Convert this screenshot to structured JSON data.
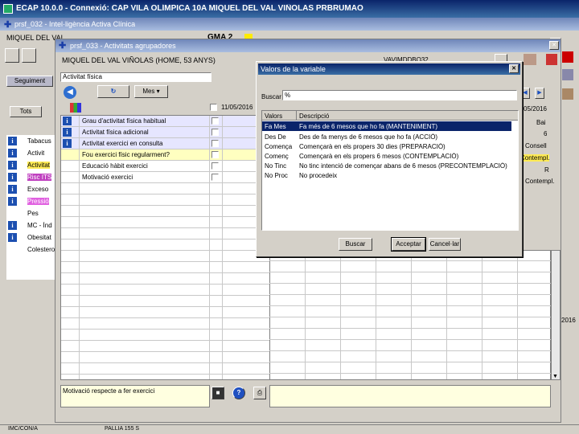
{
  "main_window": {
    "title": "ECAP 10.0.0 - Connexió: CAP VILA OLÍMPICA 10A MIQUEL DEL VAL VIÑOLAS PRBRUMAO"
  },
  "clinical_window": {
    "title": "prsf_032 - Intel·ligència Activa Clínica",
    "patient_bar": "MIQUEL DEL VAL",
    "gma_label": "GMA 2",
    "segment_btn": "Seguiment",
    "tots_label": "Tots",
    "items": [
      "Tabacus",
      "Activit",
      "Activitat",
      "Risc ITS",
      "Exceso",
      "Pressió",
      "Pes",
      "MC - Índ",
      "Obesitat",
      "Colesterol"
    ]
  },
  "status_bar": {
    "item1": "IMC/CON/A",
    "item2": "PALLIA 155 S"
  },
  "grouper_window": {
    "title": "prsf_033 - Activitats agrupadores",
    "patient": "MIQUEL DEL VAL VIÑOLAS (HOME, 53 ANYS)",
    "id": "VAVIMDDBO32",
    "category": "Activitat física",
    "period": "Mes",
    "date_col": "11/05/2016",
    "date_right": "05/2016",
    "activities": [
      "Grau d'activitat física habitual",
      "Activitat física adicional",
      "Activitat exercici en consulta",
      "Fou exercici físic regularment?",
      "Educació hàbit exercici",
      "Motivació exercici"
    ],
    "right_vals": [
      "Bai",
      "6",
      "Consell",
      "Contempl.",
      "R",
      "Contempl."
    ],
    "year_val": "2016",
    "footer": "Motivació respecte a fer exercici"
  },
  "dialog": {
    "title": "Valors de la variable",
    "search_label": "Buscar",
    "search_value": "%",
    "col_value": "Valors",
    "col_desc": "Descripció",
    "rows": [
      {
        "value": "Fa Mes",
        "desc": "Fa més de 6 mesos que ho fa (MANTENIMENT)"
      },
      {
        "value": "Des De",
        "desc": "Des de fa menys de 6 mesos que ho fa (ACCIÓ)"
      },
      {
        "value": "Comença",
        "desc": "Començarà en els propers 30 dies (PREPARACIÓ)"
      },
      {
        "value": "Començ",
        "desc": "Començarà en els propers 6 mesos (CONTEMPLACIÓ)"
      },
      {
        "value": "No Tinc",
        "desc": "No tinc intenció de començar abans de 6 mesos (PRECONTEMPLACIÓ)"
      },
      {
        "value": "No Proc",
        "desc": "No procedeix"
      }
    ],
    "buttons": {
      "search": "Buscar",
      "accept": "Acceptar",
      "cancel": "Cancel·lar"
    }
  }
}
